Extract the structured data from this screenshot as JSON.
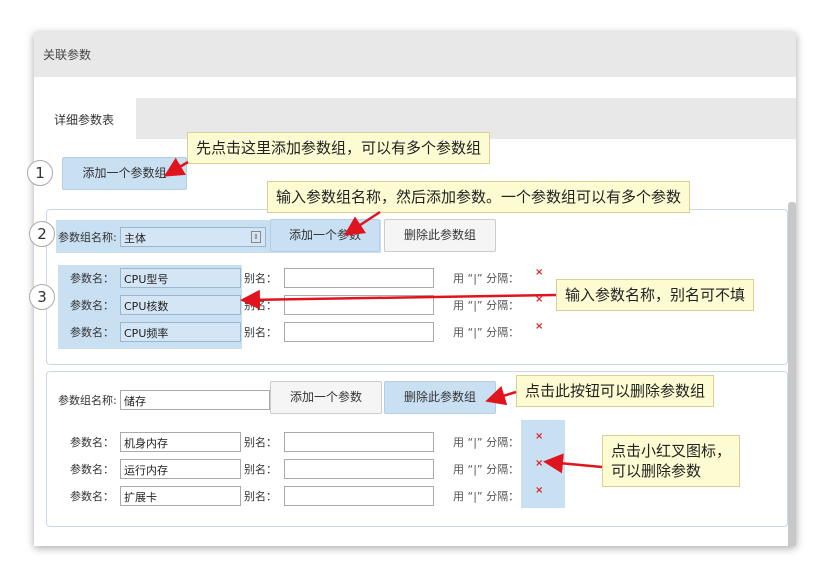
{
  "panel": {
    "title": "关联参数"
  },
  "tabs": [
    {
      "label": "详细参数表"
    }
  ],
  "toolbar": {
    "add_group_label": "添加一个参数组"
  },
  "labels": {
    "group_name": "参数组名称:",
    "param_name": "参数名：",
    "alias": "别名：",
    "separator_hint": "用 “|” 分隔：",
    "delete_mark": "×"
  },
  "groups": [
    {
      "name": "主体",
      "add_param_label": "添加一个参数",
      "delete_group_label": "删除此参数组",
      "params": [
        {
          "name": "CPU型号",
          "alias": ""
        },
        {
          "name": "CPU核数",
          "alias": ""
        },
        {
          "name": "CPU频率",
          "alias": ""
        }
      ]
    },
    {
      "name": "储存",
      "add_param_label": "添加一个参数",
      "delete_group_label": "删除此参数组",
      "params": [
        {
          "name": "机身内存",
          "alias": ""
        },
        {
          "name": "运行内存",
          "alias": ""
        },
        {
          "name": "扩展卡",
          "alias": ""
        }
      ]
    }
  ],
  "annotations": {
    "step1": "1",
    "step2": "2",
    "step3": "3",
    "callout1": "先点击这里添加参数组，可以有多个参数组",
    "callout2": "输入参数组名称，然后添加参数。一个参数组可以有多个参数",
    "callout3": "输入参数名称，别名可不填",
    "callout4": "点击此按钮可以删除参数组",
    "callout5_line1": "点击小红叉图标，",
    "callout5_line2": "可以删除参数"
  },
  "colors": {
    "highlight": "#c9dff2",
    "callout_bg": "#fdfbd2",
    "arrow": "#e0141e",
    "delete": "#e02020"
  }
}
